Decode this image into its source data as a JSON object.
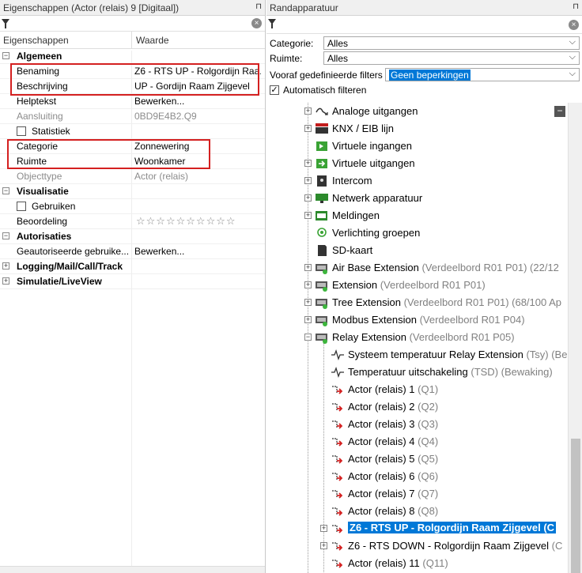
{
  "left": {
    "title": "Eigenschappen (Actor (relais) 9 [Digitaal])",
    "header": {
      "col1": "Eigenschappen",
      "col2": "Waarde"
    },
    "rows": [
      {
        "type": "group",
        "name": "Algemeen",
        "expander": "−"
      },
      {
        "type": "prop",
        "name": "Benaming",
        "value": "Z6 - RTS UP - Rolgordijn Raa..."
      },
      {
        "type": "prop",
        "name": "Beschrijving",
        "value": "UP - Gordijn Raam Zijgevel"
      },
      {
        "type": "prop",
        "name": "Helptekst",
        "value": "Bewerken..."
      },
      {
        "type": "prop-grey",
        "name": "Aansluiting",
        "value": "0BD9E4B2.Q9"
      },
      {
        "type": "check",
        "name": "Statistiek"
      },
      {
        "type": "prop",
        "name": "Categorie",
        "value": "Zonnewering"
      },
      {
        "type": "prop",
        "name": "Ruimte",
        "value": "Woonkamer"
      },
      {
        "type": "prop-grey",
        "name": "Objecttype",
        "value": "Actor (relais)"
      },
      {
        "type": "group",
        "name": "Visualisatie",
        "expander": "−"
      },
      {
        "type": "check",
        "name": "Gebruiken"
      },
      {
        "type": "stars",
        "name": "Beoordeling",
        "stars": 0,
        "max": 10
      },
      {
        "type": "group",
        "name": "Autorisaties",
        "expander": "−"
      },
      {
        "type": "prop",
        "name": "Geautoriseerde gebruike...",
        "value": "Bewerken..."
      },
      {
        "type": "group",
        "name": "Logging/Mail/Call/Track",
        "expander": "+"
      },
      {
        "type": "group",
        "name": "Simulatie/LiveView",
        "expander": "+"
      }
    ]
  },
  "right": {
    "title": "Randapparatuur",
    "filters": {
      "categorie_label": "Categorie:",
      "categorie_value": "Alles",
      "ruimte_label": "Ruimte:",
      "ruimte_value": "Alles",
      "vooraf_label": "Vooraf gedefinieerde filters",
      "vooraf_value": "Geen beperkingen",
      "auto_label": "Automatisch filteren",
      "auto_checked": "✓"
    },
    "tree": [
      {
        "text": "Analoge uitgangen",
        "sub": "",
        "icon": "analog",
        "exp": "+"
      },
      {
        "text": "KNX / EIB lijn",
        "sub": "",
        "icon": "knx",
        "exp": "+"
      },
      {
        "text": "Virtuele ingangen",
        "sub": "",
        "icon": "vin",
        "exp": ""
      },
      {
        "text": "Virtuele uitgangen",
        "sub": "",
        "icon": "vout",
        "exp": "+"
      },
      {
        "text": "Intercom",
        "sub": "",
        "icon": "intercom",
        "exp": "+"
      },
      {
        "text": "Netwerk apparatuur",
        "sub": "",
        "icon": "net",
        "exp": "+"
      },
      {
        "text": "Meldingen",
        "sub": "",
        "icon": "msg",
        "exp": "+"
      },
      {
        "text": "Verlichting groepen",
        "sub": "",
        "icon": "light",
        "exp": ""
      },
      {
        "text": "SD-kaart",
        "sub": "",
        "icon": "sd",
        "exp": ""
      },
      {
        "text": "Air Base Extension",
        "sub": " (Verdeelbord R01 P01) (22/12",
        "icon": "ext",
        "exp": "+"
      },
      {
        "text": "Extension",
        "sub": " (Verdeelbord R01 P01)",
        "icon": "ext",
        "exp": "+"
      },
      {
        "text": "Tree Extension",
        "sub": " (Verdeelbord R01 P01) (68/100 Ap",
        "icon": "ext",
        "exp": "+"
      },
      {
        "text": "Modbus Extension",
        "sub": " (Verdeelbord R01 P04)",
        "icon": "ext",
        "exp": "+"
      },
      {
        "text": "Relay Extension",
        "sub": " (Verdeelbord R01 P05)",
        "icon": "ext",
        "exp": "−"
      },
      {
        "text": "Systeem temperatuur Relay Extension",
        "sub": " (Tsy) (Be",
        "icon": "wave",
        "exp": "",
        "child": true
      },
      {
        "text": "Temperatuur uitschakeling",
        "sub": " (TSD) (Bewaking)",
        "icon": "wave",
        "exp": "",
        "child": true
      },
      {
        "text": "Actor (relais) 1",
        "sub": " (Q1)",
        "icon": "relay",
        "exp": "",
        "child": true
      },
      {
        "text": "Actor (relais) 2",
        "sub": " (Q2)",
        "icon": "relay",
        "exp": "",
        "child": true
      },
      {
        "text": "Actor (relais) 3",
        "sub": " (Q3)",
        "icon": "relay",
        "exp": "",
        "child": true
      },
      {
        "text": "Actor (relais) 4",
        "sub": " (Q4)",
        "icon": "relay",
        "exp": "",
        "child": true
      },
      {
        "text": "Actor (relais) 5",
        "sub": " (Q5)",
        "icon": "relay",
        "exp": "",
        "child": true
      },
      {
        "text": "Actor (relais) 6",
        "sub": " (Q6)",
        "icon": "relay",
        "exp": "",
        "child": true
      },
      {
        "text": "Actor (relais) 7",
        "sub": " (Q7)",
        "icon": "relay",
        "exp": "",
        "child": true
      },
      {
        "text": "Actor (relais) 8",
        "sub": " (Q8)",
        "icon": "relay",
        "exp": "",
        "child": true
      },
      {
        "text": "Z6 - RTS UP - Rolgordijn Raam Zijgevel (C",
        "sub": "",
        "icon": "relay",
        "exp": "+",
        "child": true,
        "selected": true
      },
      {
        "text": "Z6 - RTS DOWN - Rolgordijn Raam Zijgevel",
        "sub": " (C",
        "icon": "relay",
        "exp": "+",
        "child": true
      },
      {
        "text": "Actor (relais) 11",
        "sub": " (Q11)",
        "icon": "relay",
        "exp": "",
        "child": true
      }
    ]
  },
  "icons": {
    "pin": "pin-icon",
    "filter": "funnel-icon",
    "clear": "clear-icon",
    "dropdown": "chevron-down-icon"
  },
  "colors": {
    "highlight": "#0078d7",
    "annotation": "#d42020",
    "grey_text": "#8c8c8c"
  },
  "glyphs": {
    "pin": "⊓",
    "clear": "×",
    "dropdown": "⌵",
    "collapse": "−"
  }
}
